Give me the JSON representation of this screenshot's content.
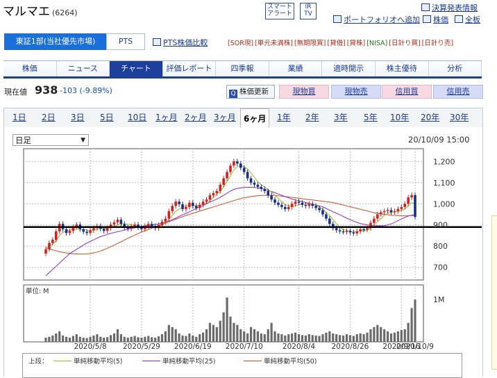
{
  "header": {
    "name": "マルマエ",
    "code": "(6264)",
    "smart_alert": "スマート アラート",
    "ir_tv": "IR TV",
    "links": {
      "kessan": "決算発表情報",
      "portfolio": "ポートフォリオへ追加",
      "kabuka": "株価",
      "zenban": "全板"
    }
  },
  "market": {
    "tab1": "東証1部(当社優先市場)",
    "tab2": "PTS",
    "pts_link": "PTS株価比較"
  },
  "badges": [
    "[SOR現]",
    "[単元未満株]",
    "[無期限買]",
    "[貸借]",
    "[貸株]",
    "[NISA]",
    "[日計り買]",
    "[日計り売]"
  ],
  "nav": [
    "株価",
    "ニュース",
    "チャート",
    "評価レポート",
    "四季報",
    "業績",
    "適時開示",
    "株主優待",
    "分析"
  ],
  "price_row": {
    "label": "現在値",
    "price": "938",
    "change": "-103 (-9.89%)",
    "refresh": "株価更新",
    "buttons": [
      "現物買",
      "現物売",
      "信用買",
      "信用売"
    ]
  },
  "periods": [
    "1日",
    "2日",
    "3日",
    "5日",
    "10日",
    "1ヶ月",
    "2ヶ月",
    "3ヶ月",
    "6ヶ月",
    "1年",
    "2年",
    "3年",
    "5年",
    "10年",
    "20年",
    "30年"
  ],
  "selected_period": "6ヶ月",
  "chart_controls": {
    "interval": "日足",
    "timestamp": "20/10/09 15:00"
  },
  "legend": {
    "label": "上段：",
    "items": [
      {
        "name": "単純移動平均(5)",
        "color": "#9fb82a"
      },
      {
        "name": "単純移動平均(25)",
        "color": "#8a2bd6"
      },
      {
        "name": "単純移動平均(50)",
        "color": "#d84a1e"
      }
    ]
  },
  "chart_data": [
    {
      "type": "candlestick",
      "title": "",
      "y_ticks": [
        700,
        800,
        900,
        1000,
        1100,
        1200
      ],
      "ylim": [
        640,
        1260
      ],
      "x_ticks": [
        "2020/5/8",
        "2020/5/29",
        "2020/6/19",
        "2020/7/10",
        "2020/8/4",
        "2020/8/26",
        "2020/9/16",
        "2020/10/9"
      ],
      "reference_line": 890,
      "colors": {
        "up": "#d62020",
        "down": "#1a2f8c"
      },
      "close": [
        785,
        815,
        830,
        870,
        905,
        880,
        862,
        872,
        890,
        902,
        880,
        868,
        862,
        875,
        885,
        895,
        882,
        872,
        885,
        902,
        912,
        925,
        905,
        888,
        882,
        895,
        902,
        888,
        880,
        895,
        905,
        895,
        885,
        900,
        915,
        930,
        965,
        990,
        1010,
        998,
        975,
        985,
        1005,
        990,
        980,
        995,
        1010,
        1020,
        1040,
        1050,
        1060,
        1090,
        1120,
        1150,
        1180,
        1200,
        1190,
        1170,
        1150,
        1120,
        1100,
        1090,
        1080,
        1070,
        1060,
        1040,
        1020,
        1005,
        995,
        985,
        975,
        985,
        1000,
        1010,
        1005,
        995,
        990,
        1000,
        990,
        980,
        970,
        950,
        930,
        905,
        885,
        875,
        870,
        868,
        872,
        865,
        860,
        870,
        880,
        878,
        885,
        910,
        930,
        950,
        960,
        965,
        970,
        960,
        965,
        975,
        985,
        1000,
        1030,
        1041,
        938
      ],
      "ma5": [
        790,
        800,
        810,
        825,
        850,
        865,
        870,
        875,
        880,
        880,
        880,
        877,
        875,
        874,
        875,
        880,
        884,
        884,
        884,
        888,
        893,
        900,
        905,
        905,
        903,
        900,
        897,
        893,
        890,
        890,
        893,
        894,
        894,
        895,
        900,
        910,
        925,
        945,
        965,
        975,
        985,
        990,
        993,
        990,
        990,
        993,
        998,
        1005,
        1015,
        1030,
        1045,
        1060,
        1080,
        1105,
        1130,
        1160,
        1175,
        1180,
        1175,
        1165,
        1145,
        1125,
        1105,
        1090,
        1080,
        1068,
        1055,
        1040,
        1025,
        1010,
        997,
        990,
        988,
        990,
        995,
        998,
        1000,
        1000,
        997,
        992,
        985,
        975,
        960,
        945,
        925,
        905,
        890,
        880,
        873,
        870,
        868,
        868,
        870,
        873,
        876,
        886,
        900,
        915,
        930,
        945,
        955,
        960,
        962,
        965,
        968,
        975,
        990,
        1005,
        1000
      ],
      "ma25": [
        660,
        675,
        690,
        705,
        720,
        735,
        750,
        765,
        775,
        785,
        795,
        805,
        815,
        822,
        830,
        838,
        845,
        850,
        856,
        860,
        864,
        868,
        872,
        876,
        880,
        884,
        887,
        890,
        893,
        896,
        898,
        900,
        902,
        905,
        908,
        912,
        918,
        925,
        932,
        940,
        948,
        955,
        962,
        970,
        978,
        985,
        992,
        1000,
        1008,
        1015,
        1022,
        1030,
        1040,
        1050,
        1060,
        1068,
        1072,
        1075,
        1077,
        1078,
        1078,
        1077,
        1075,
        1072,
        1068,
        1063,
        1058,
        1052,
        1046,
        1040,
        1034,
        1028,
        1022,
        1018,
        1014,
        1010,
        1006,
        1002,
        998,
        994,
        990,
        985,
        978,
        970,
        962,
        955,
        948,
        940,
        932,
        925,
        918,
        912,
        907,
        903,
        900,
        898,
        897,
        896,
        896,
        897,
        900,
        905,
        912,
        920,
        928,
        935,
        942,
        946,
        948
      ],
      "ma50": [
        790,
        786,
        782,
        778,
        774,
        771,
        768,
        766,
        764,
        763,
        762,
        762,
        763,
        765,
        768,
        772,
        777,
        783,
        790,
        797,
        805,
        813,
        821,
        829,
        837,
        845,
        852,
        859,
        866,
        873,
        879,
        885,
        891,
        897,
        903,
        909,
        915,
        921,
        927,
        933,
        939,
        945,
        950,
        955,
        960,
        965,
        970,
        975,
        980,
        985,
        990,
        995,
        1000,
        1005,
        1010,
        1015,
        1020,
        1024,
        1028,
        1031,
        1034,
        1036,
        1038,
        1039,
        1040,
        1040,
        1040,
        1039,
        1038,
        1036,
        1034,
        1032,
        1030,
        1028,
        1026,
        1024,
        1022,
        1020,
        1018,
        1016,
        1014,
        1012,
        1010,
        1008,
        1005,
        1002,
        998,
        994,
        990,
        986,
        982,
        978,
        974,
        970,
        966,
        962,
        958,
        955,
        952,
        950,
        948,
        946,
        945,
        944,
        943,
        943,
        943,
        944,
        945
      ],
      "volume_ticks": [
        "1M"
      ],
      "volume_unit": "単位: M",
      "volume": [
        0.1,
        0.12,
        0.15,
        0.2,
        0.25,
        0.15,
        0.12,
        0.1,
        0.14,
        0.18,
        0.12,
        0.1,
        0.09,
        0.12,
        0.15,
        0.18,
        0.12,
        0.1,
        0.11,
        0.16,
        0.2,
        0.3,
        0.18,
        0.12,
        0.1,
        0.12,
        0.14,
        0.11,
        0.1,
        0.12,
        0.14,
        0.11,
        0.1,
        0.13,
        0.18,
        0.25,
        0.4,
        0.35,
        0.3,
        0.2,
        0.15,
        0.14,
        0.2,
        0.15,
        0.12,
        0.18,
        0.22,
        0.3,
        0.45,
        0.4,
        0.35,
        0.5,
        0.7,
        1.05,
        0.6,
        0.45,
        0.4,
        0.3,
        0.25,
        0.2,
        0.35,
        0.3,
        0.25,
        0.2,
        0.18,
        0.3,
        0.45,
        0.25,
        0.2,
        0.18,
        0.15,
        0.18,
        0.2,
        0.22,
        0.18,
        0.16,
        0.15,
        0.18,
        0.16,
        0.15,
        0.14,
        0.18,
        0.22,
        0.25,
        0.2,
        0.18,
        0.16,
        0.15,
        0.18,
        0.16,
        0.14,
        0.18,
        0.2,
        0.18,
        0.22,
        0.3,
        0.35,
        0.4,
        0.35,
        0.3,
        0.25,
        0.2,
        0.22,
        0.25,
        0.28,
        0.3,
        0.45,
        0.8,
        1.0
      ]
    }
  ]
}
